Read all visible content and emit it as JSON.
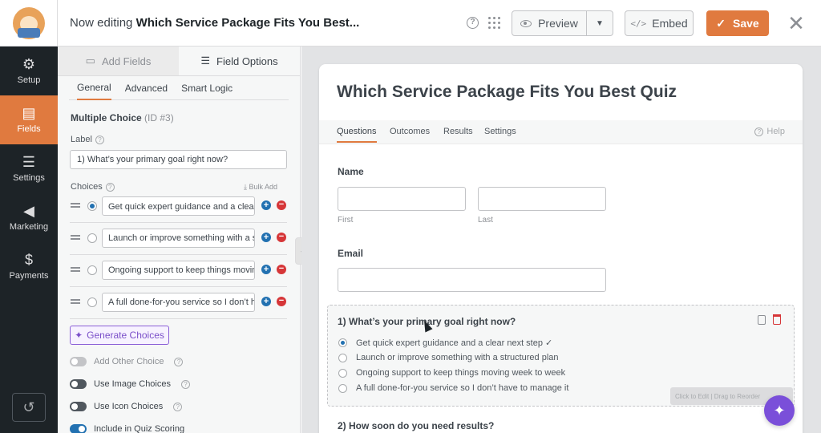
{
  "header": {
    "editing_prefix": "Now editing",
    "form_name": "Which Service Package Fits You Best...",
    "preview_label": "Preview",
    "embed_label": "Embed",
    "save_label": "Save"
  },
  "nav": {
    "items": [
      {
        "label": "Setup",
        "icon": "gear-icon"
      },
      {
        "label": "Fields",
        "icon": "fields-icon"
      },
      {
        "label": "Settings",
        "icon": "sliders-icon"
      },
      {
        "label": "Marketing",
        "icon": "megaphone-icon"
      },
      {
        "label": "Payments",
        "icon": "dollar-icon"
      }
    ],
    "active": "Fields"
  },
  "panel": {
    "tabs": [
      "Add Fields",
      "Field Options"
    ],
    "subtabs": [
      "General",
      "Advanced",
      "Smart Logic"
    ],
    "field_type": "Multiple Choice",
    "field_id": "(ID #3)",
    "label_caption": "Label",
    "label_value": "1) What’s your primary goal right now?",
    "choices_caption": "Choices",
    "bulk_add": "Bulk Add",
    "choices": [
      "Get quick expert guidance and a clear next step ✓",
      "Launch or improve something with a structured plan",
      "Ongoing support to keep things moving week to week",
      "A full done-for-you service so I don’t have to manage it"
    ],
    "generate_label": "Generate Choices",
    "toggles": [
      {
        "label": "Add Other Choice",
        "state": "disabled"
      },
      {
        "label": "Use Image Choices",
        "state": "off"
      },
      {
        "label": "Use Icon Choices",
        "state": "off"
      },
      {
        "label": "Include in Quiz Scoring",
        "state": "on"
      }
    ]
  },
  "form": {
    "title": "Which Service Package Fits You Best Quiz",
    "tabs": [
      "Questions",
      "Outcomes",
      "Results",
      "Settings"
    ],
    "help_label": "Help",
    "name_label": "Name",
    "first_label": "First",
    "last_label": "Last",
    "email_label": "Email",
    "q1_title": "1) What’s your primary goal right now?",
    "q1_options": [
      "Get quick expert guidance and a clear next step ✓",
      "Launch or improve something with a structured plan",
      "Ongoing support to keep things moving week to week",
      "A full done-for-you service so I don’t have to manage it"
    ],
    "q1_hint": "Click to Edit | Drag to Reorder",
    "q2_title": "2) How soon do you need results?"
  },
  "colors": {
    "accent": "#e07a3f",
    "nav_bg": "#1d2327",
    "ai_purple": "#7a4fd9"
  }
}
